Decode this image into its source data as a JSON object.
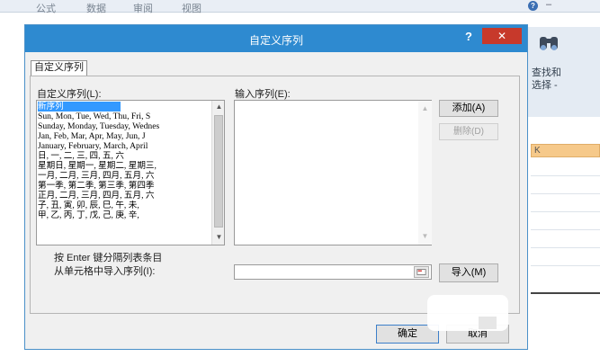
{
  "background": {
    "menu_items": [
      "公式",
      "数据",
      "审阅",
      "视图"
    ],
    "help_glyph": "?",
    "minimize_glyph": "–",
    "find_label": "查找和",
    "select_label": "选择 -",
    "column_header": "K"
  },
  "dialog": {
    "title": "自定义序列",
    "help_glyph": "?",
    "close_glyph": "✕",
    "tab_label": "自定义序列",
    "lists_label": "自定义序列(L):",
    "entries_label": "输入序列(E):",
    "lists": [
      "新序列",
      "Sun, Mon, Tue, Wed, Thu, Fri, S",
      "Sunday, Monday, Tuesday, Wednes",
      "Jan, Feb, Mar, Apr, May, Jun, J",
      "January, February, March, April",
      "日, 一, 二, 三, 四, 五, 六",
      "星期日, 星期一, 星期二, 星期三,",
      "一月, 二月, 三月, 四月, 五月, 六",
      "第一季, 第二季, 第三季, 第四季",
      "正月, 二月, 三月, 四月, 五月, 六",
      "子, 丑, 寅, 卯, 辰, 巳, 午, 未,",
      "甲, 乙, 丙, 丁, 戊, 己, 庚, 辛,"
    ],
    "add_label": "添加(A)",
    "delete_label": "删除(D)",
    "hint_text": "按 Enter 键分隔列表条目",
    "import_label": "从单元格中导入序列(I):",
    "import_button_label": "导入(M)",
    "ok_label": "确定",
    "cancel_label": "取消"
  },
  "colors": {
    "titlebar": "#2e8ad0",
    "close": "#c7392b",
    "selection": "#3399ff"
  }
}
